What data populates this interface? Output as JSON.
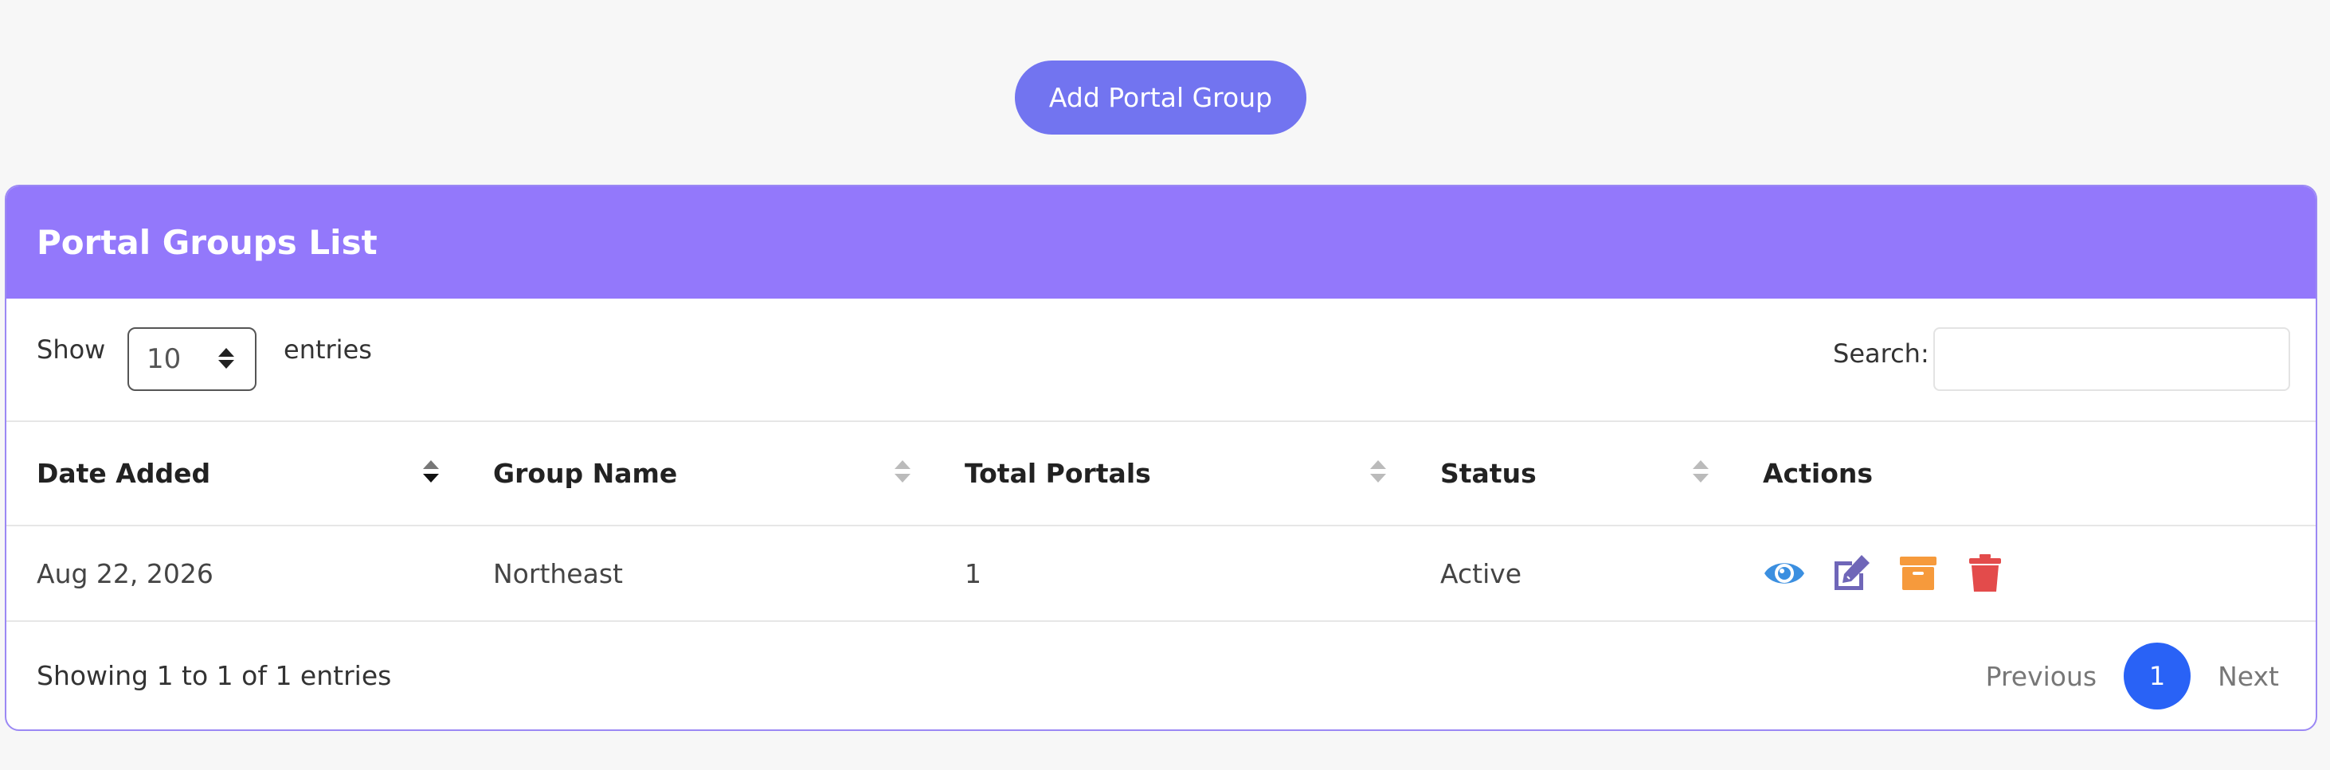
{
  "toolbar": {
    "add_label": "Add Portal Group"
  },
  "card": {
    "title": "Portal Groups List"
  },
  "controls": {
    "show_label": "Show",
    "page_size": "10",
    "entries_label": "entries",
    "search_label": "Search:",
    "search_value": ""
  },
  "table": {
    "columns": [
      "Date Added",
      "Group Name",
      "Total Portals",
      "Status",
      "Actions"
    ],
    "rows": [
      {
        "date_added": "Aug 22, 2026",
        "group_name": "Northeast",
        "total_portals": "1",
        "status": "Active"
      }
    ]
  },
  "actions": {
    "icons": [
      "eye-icon",
      "edit-icon",
      "archive-icon",
      "trash-icon"
    ],
    "colors": {
      "view": "#3b8fe0",
      "edit": "#6f66b8",
      "archive": "#f69a3c",
      "delete": "#e34b4b"
    }
  },
  "footer": {
    "info": "Showing 1 to 1 of 1 entries",
    "previous": "Previous",
    "current_page": "1",
    "next": "Next"
  },
  "colors": {
    "accent": "#7274f0",
    "header": "#9378fb",
    "page_active": "#2962f6"
  }
}
